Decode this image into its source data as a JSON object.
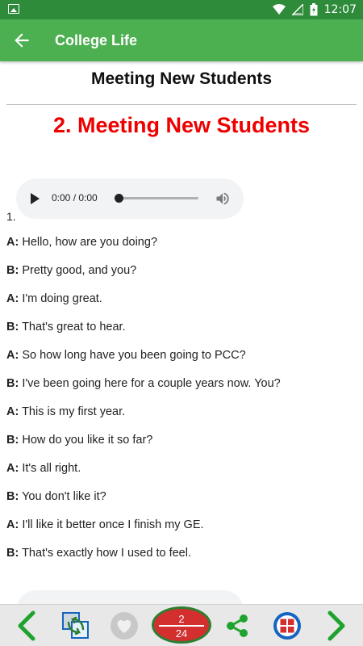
{
  "status_bar": {
    "time": "12:07"
  },
  "app_bar": {
    "title": "College Life"
  },
  "page_heading": "Meeting New Students",
  "lesson_title": "2. Meeting New Students",
  "audio": {
    "time": "0:00 / 0:00",
    "progress": 0
  },
  "item_number": "1.",
  "dialogue": [
    {
      "speaker": "A:",
      "text": " Hello, how are you doing?"
    },
    {
      "speaker": "B:",
      "text": " Pretty good, and you?"
    },
    {
      "speaker": "A:",
      "text": " I'm doing great."
    },
    {
      "speaker": "B:",
      "text": " That's great to hear."
    },
    {
      "speaker": "A:",
      "text": " So how long have you been going to PCC?"
    },
    {
      "speaker": "B:",
      "text": " I've been going here for a couple years now. You?"
    },
    {
      "speaker": "A:",
      "text": " This is my first year."
    },
    {
      "speaker": "B:",
      "text": " How do you like it so far?"
    },
    {
      "speaker": "A:",
      "text": " It's all right."
    },
    {
      "speaker": "B:",
      "text": " You don't like it?"
    },
    {
      "speaker": "A:",
      "text": " I'll like it better once I finish my GE."
    },
    {
      "speaker": "B:",
      "text": " That's exactly how I used to feel."
    }
  ],
  "bottom_bar": {
    "current_page": "2",
    "total_pages": "24",
    "icons": [
      "chevron-left-icon",
      "switch-icon",
      "heart-icon",
      "share-icon",
      "grid-menu-icon",
      "chevron-right-icon"
    ]
  },
  "colors": {
    "status_bar": "#2e8b3a",
    "app_bar": "#4caf50",
    "lesson_title": "#ee0000",
    "nav_arrow": "#1fa32e"
  }
}
